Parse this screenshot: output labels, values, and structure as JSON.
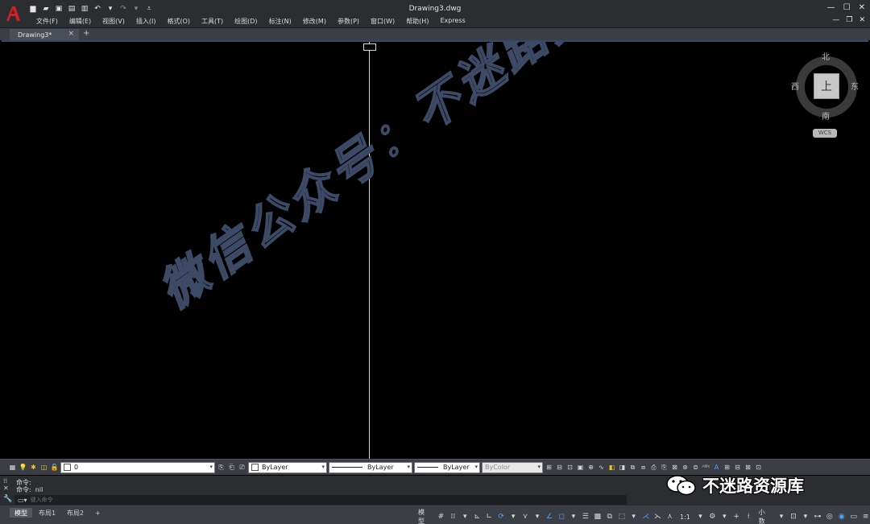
{
  "app": {
    "title": "Drawing3.dwg",
    "logo_letter": "A",
    "menu": [
      "文件(F)",
      "编辑(E)",
      "视图(V)",
      "插入(I)",
      "格式(O)",
      "工具(T)",
      "绘图(D)",
      "标注(N)",
      "修改(M)",
      "参数(P)",
      "窗口(W)",
      "帮助(H)",
      "Express"
    ]
  },
  "tabs": {
    "active": "Drawing3*",
    "close": "×",
    "add": "+"
  },
  "canvas": {
    "watermark": "微信公众号：不迷路资源库"
  },
  "viewcube": {
    "north": "北",
    "south": "南",
    "east": "东",
    "west": "西",
    "face": "上",
    "wcs": "WCS"
  },
  "properties": {
    "layer": "0",
    "color": "ByLayer",
    "linetype": "ByLayer",
    "lineweight": "ByLayer",
    "plotstyle": "ByColor"
  },
  "command": {
    "history": [
      "命令:",
      "命令:  nil"
    ],
    "placeholder": "键入命令"
  },
  "status": {
    "layouts": [
      "模型",
      "布局1",
      "布局2"
    ],
    "add": "+",
    "model": "模型",
    "scale": "1:1",
    "units": "小数"
  },
  "badge": {
    "label": "不迷路资源库"
  },
  "colors": {
    "accent": "#4ea1ff",
    "logo": "#d11f26"
  }
}
